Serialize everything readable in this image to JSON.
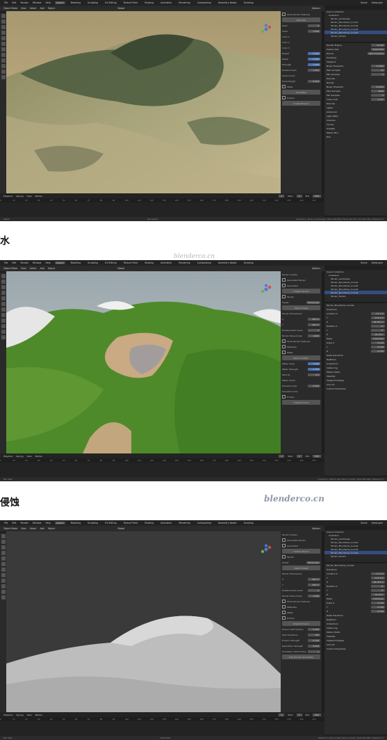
{
  "menu": {
    "items": [
      "File",
      "Edit",
      "Render",
      "Window",
      "Help"
    ],
    "workspaces": [
      "Layout",
      "Modeling",
      "Sculpting",
      "UV Editing",
      "Texture Paint",
      "Shading",
      "Animation",
      "Rendering",
      "Compositing",
      "Geometry Nodes",
      "Scripting"
    ],
    "active_workspace": "Layout",
    "scene": "Scene",
    "view_layer": "ViewLayer"
  },
  "viewport_header": {
    "mode": "Object Mode",
    "view": "View",
    "select": "Select",
    "add": "Add",
    "object": "Object",
    "shading": "Global",
    "options": "Options"
  },
  "timeline": {
    "playback": "Playback",
    "keying": "Keying",
    "view": "View",
    "marker": "Marker",
    "current_frame": "1",
    "start_label": "Start",
    "start": "1",
    "end_label": "End",
    "end": "250",
    "ticks": [
      "0",
      "10",
      "20",
      "30",
      "40",
      "50",
      "60",
      "70",
      "80",
      "90",
      "100",
      "110",
      "120",
      "130",
      "140",
      "150",
      "160",
      "170",
      "180",
      "190",
      "200",
      "210",
      "220",
      "230",
      "240",
      "250"
    ]
  },
  "panels": [
    {
      "caption": "",
      "status_left": "Select",
      "status_mid": "Box Select",
      "status_right": "Collection | Terrain_Landscape | Verts 262,656 | Faces 261,121 | Tris 522,242 | Objects 1/7",
      "n_rows": [
        {
          "k": "Show Terrain Features",
          "v": "",
          "t": "check"
        },
        {
          "k": "Relocate",
          "v": "",
          "t": "btn"
        },
        {
          "k": "Seed",
          "v": "0",
          "t": "val"
        },
        {
          "k": "Scale",
          "v": "1.000",
          "t": "val"
        },
        {
          "k": "Color 1",
          "v": "",
          "t": "val"
        },
        {
          "k": "Color 2",
          "v": "",
          "t": "val"
        },
        {
          "k": "Color 3",
          "v": "",
          "t": "val"
        },
        {
          "k": "Height",
          "v": "0.300",
          "t": "blue"
        },
        {
          "k": "Detail",
          "v": "0.500",
          "t": "blue"
        },
        {
          "k": "Strength",
          "v": "1.000",
          "t": "blue"
        },
        {
          "k": "Displacement",
          "v": "1.000",
          "t": "val"
        },
        {
          "k": "Snow Colour",
          "v": "",
          "t": "val"
        },
        {
          "k": "Snow Height",
          "v": "0.500",
          "t": "val"
        },
        {
          "k": "Water",
          "v": "",
          "t": "check"
        },
        {
          "k": "Add Water",
          "v": "",
          "t": "btn"
        },
        {
          "k": "Erosion",
          "v": "",
          "t": "check"
        },
        {
          "k": "Create Erosion",
          "v": "",
          "t": "btn"
        }
      ],
      "outliner": [
        "Scene Collection",
        "Collection",
        "Terrain_Landscape",
        "Terrain_Mountains_Curve1",
        "Terrain_Mountains_Curve2",
        "Terrain_Mountains_Curve3",
        "Terrain_Mountains_Curve4",
        "Terrain_Terrain"
      ],
      "props": [
        {
          "k": "Render Engine",
          "v": "Cycles"
        },
        {
          "k": "Feature Set",
          "v": "Supported"
        },
        {
          "k": "Device",
          "v": "GPU Compute"
        },
        {
          "k": "Sampling",
          "v": ""
        },
        {
          "k": "Viewport",
          "v": ""
        },
        {
          "k": "Noise Threshold",
          "v": "0.1000"
        },
        {
          "k": "Max Samples",
          "v": "32"
        },
        {
          "k": "Min Samples",
          "v": "0"
        },
        {
          "k": "Denoise",
          "v": ""
        },
        {
          "k": "Render",
          "v": ""
        },
        {
          "k": "Noise Threshold",
          "v": "0.0100"
        },
        {
          "k": "Max Samples",
          "v": "4096"
        },
        {
          "k": "Min Samples",
          "v": "0"
        },
        {
          "k": "Time Limit",
          "v": "0 sec"
        },
        {
          "k": "Denoise",
          "v": ""
        },
        {
          "k": "Lights",
          "v": ""
        },
        {
          "k": "Advanced",
          "v": ""
        },
        {
          "k": "Light Paths",
          "v": ""
        },
        {
          "k": "Volumes",
          "v": ""
        },
        {
          "k": "Curves",
          "v": ""
        },
        {
          "k": "Simplify",
          "v": ""
        },
        {
          "k": "Motion Blur",
          "v": ""
        },
        {
          "k": "Film",
          "v": ""
        }
      ]
    },
    {
      "caption": "水",
      "status_left": "Pan View",
      "status_mid": "",
      "status_right": "Collection | Terrain_Mountains_Curve4 | Verts 262,656 | Objects 1/7",
      "n_rows": [
        {
          "k": "Terrain Creator",
          "v": "",
          "t": "head"
        },
        {
          "k": "Generated Terrain",
          "v": "",
          "t": "check"
        },
        {
          "k": "Generated",
          "v": "",
          "t": "check"
        },
        {
          "k": "Finalize Terrain",
          "v": "",
          "t": "btn"
        },
        {
          "k": "Terrain",
          "v": "",
          "t": "check"
        },
        {
          "k": "Preset",
          "v": "Temperate",
          "t": "val"
        },
        {
          "k": "Select Preset",
          "v": "",
          "t": "btn"
        },
        {
          "k": "Terrain Dimensions",
          "v": "",
          "t": "head"
        },
        {
          "k": "X",
          "v": "200 m",
          "t": "val"
        },
        {
          "k": "Y",
          "v": "200 m",
          "t": "val"
        },
        {
          "k": "Displacement Level",
          "v": "5",
          "t": "val"
        },
        {
          "k": "Terrain Noise Scale",
          "v": "1.000",
          "t": "val"
        },
        {
          "k": "Show Terrain Features",
          "v": "",
          "t": "check"
        },
        {
          "k": "Materials",
          "v": "",
          "t": "check"
        },
        {
          "k": "Water",
          "v": "",
          "t": "check"
        },
        {
          "k": "Remove Water",
          "v": "",
          "t": "btn"
        },
        {
          "k": "Water Scale",
          "v": "1.000",
          "t": "blue"
        },
        {
          "k": "Water Strength",
          "v": "0.100",
          "t": "blue"
        },
        {
          "k": "Opacity",
          "v": "0.5",
          "t": "val"
        },
        {
          "k": "Water Colour",
          "v": "",
          "t": "val"
        },
        {
          "k": "Shoreline Size",
          "v": "0.500",
          "t": "val"
        },
        {
          "k": "Shoreline Color",
          "v": "",
          "t": "orange"
        },
        {
          "k": "Erosion",
          "v": "",
          "t": "check"
        },
        {
          "k": "Create Erosion",
          "v": "",
          "t": "btn"
        }
      ],
      "outliner": [
        "Scene Collection",
        "Collection",
        "Terrain_Landscape",
        "Terrain_Mountains_Curve1",
        "Terrain_Mountains_Curve2",
        "Terrain_Mountains_Curve3",
        "Terrain_Mountains_Curve4",
        "Terrain_Terrain"
      ],
      "props": [
        {
          "k": "Terrain_Mountains_Curve4",
          "v": ""
        },
        {
          "k": "Transform",
          "v": ""
        },
        {
          "k": "Location X",
          "v": "-77.7 m"
        },
        {
          "k": "Y",
          "v": "-113.9 m"
        },
        {
          "k": "Z",
          "v": "-36.784 m"
        },
        {
          "k": "Rotation X",
          "v": "0°"
        },
        {
          "k": "Y",
          "v": "0°"
        },
        {
          "k": "Z",
          "v": "-91.471°"
        },
        {
          "k": "Mode",
          "v": "XYZ Euler"
        },
        {
          "k": "Scale X",
          "v": "0.518"
        },
        {
          "k": "Y",
          "v": "0.518"
        },
        {
          "k": "Z",
          "v": "0.518"
        },
        {
          "k": "Delta Transform",
          "v": ""
        },
        {
          "k": "Relations",
          "v": ""
        },
        {
          "k": "Collections",
          "v": ""
        },
        {
          "k": "Instancing",
          "v": ""
        },
        {
          "k": "Motion Paths",
          "v": ""
        },
        {
          "k": "Visibility",
          "v": ""
        },
        {
          "k": "Viewport Display",
          "v": ""
        },
        {
          "k": "Line Art",
          "v": ""
        },
        {
          "k": "Custom Properties",
          "v": ""
        }
      ]
    },
    {
      "caption": "侵蚀",
      "status_left": "Pan View",
      "status_mid": "Dolly View",
      "status_right": "Collection | Terrain_Mountains_Curve4 | Verts 262,656 | Objects 1/7",
      "n_rows": [
        {
          "k": "Terrain Creator",
          "v": "",
          "t": "head"
        },
        {
          "k": "Generated Terrain",
          "v": "",
          "t": "check"
        },
        {
          "k": "Generated",
          "v": "",
          "t": "check"
        },
        {
          "k": "Finalize Terrain",
          "v": "",
          "t": "btn"
        },
        {
          "k": "Terrain",
          "v": "",
          "t": "check"
        },
        {
          "k": "Preset",
          "v": "Temperate",
          "t": "val"
        },
        {
          "k": "Select Preset",
          "v": "",
          "t": "btn"
        },
        {
          "k": "Terrain Dimensions",
          "v": "",
          "t": "head"
        },
        {
          "k": "X",
          "v": "200 m",
          "t": "val"
        },
        {
          "k": "Y",
          "v": "200 m",
          "t": "val"
        },
        {
          "k": "Displacement Level",
          "v": "5",
          "t": "val"
        },
        {
          "k": "Terrain Noise Scale",
          "v": "1.000",
          "t": "val"
        },
        {
          "k": "Show Terrain Features",
          "v": "",
          "t": "check"
        },
        {
          "k": "Materials",
          "v": "",
          "t": "check"
        },
        {
          "k": "Water",
          "v": "",
          "t": "check"
        },
        {
          "k": "Erosion",
          "v": "",
          "t": "check"
        },
        {
          "k": "Disable Erosion",
          "v": "",
          "t": "btn"
        },
        {
          "k": "Erosion Point Radius",
          "v": "0.400",
          "t": "val"
        },
        {
          "k": "Point Iterations",
          "v": "100",
          "t": "val"
        },
        {
          "k": "Erosion Strength",
          "v": "0.700",
          "t": "val"
        },
        {
          "k": "Deposition Strength",
          "v": "0.500",
          "t": "val"
        },
        {
          "k": "Simulation Start Frame",
          "v": "1",
          "t": "val"
        },
        {
          "k": "Stop Erosion Simulation",
          "v": "",
          "t": "btn"
        }
      ],
      "outliner": [
        "Scene Collection",
        "Collection",
        "Terrain_Landscape",
        "Terrain_Mountains_Curve1",
        "Terrain_Mountains_Curve2",
        "Terrain_Mountains_Curve3",
        "Terrain_Mountains_Curve4",
        "Terrain_Terrain"
      ],
      "props": [
        {
          "k": "Terrain_Mountains_Curve4",
          "v": ""
        },
        {
          "k": "Transform",
          "v": ""
        },
        {
          "k": "Location X",
          "v": "-77.7 m"
        },
        {
          "k": "Y",
          "v": "-113.9 m"
        },
        {
          "k": "Z",
          "v": "-36.784 m"
        },
        {
          "k": "Rotation X",
          "v": "0°"
        },
        {
          "k": "Y",
          "v": "0°"
        },
        {
          "k": "Z",
          "v": "-91.471°"
        },
        {
          "k": "Mode",
          "v": "XYZ Euler"
        },
        {
          "k": "Scale X",
          "v": "0.518"
        },
        {
          "k": "Y",
          "v": "0.518"
        },
        {
          "k": "Z",
          "v": "0.518"
        },
        {
          "k": "Delta Transform",
          "v": ""
        },
        {
          "k": "Relations",
          "v": ""
        },
        {
          "k": "Collections",
          "v": ""
        },
        {
          "k": "Instancing",
          "v": ""
        },
        {
          "k": "Motion Paths",
          "v": ""
        },
        {
          "k": "Visibility",
          "v": ""
        },
        {
          "k": "Viewport Display",
          "v": ""
        },
        {
          "k": "Line Art",
          "v": ""
        },
        {
          "k": "Custom Properties",
          "v": ""
        }
      ]
    }
  ],
  "watermarks": {
    "small": "blenderco.cn",
    "large": "blenderco.cn"
  },
  "colors": {
    "ui_dark": "#1d1d1d",
    "accent_blue": "#4772b3",
    "shore": "#c98b4a"
  }
}
